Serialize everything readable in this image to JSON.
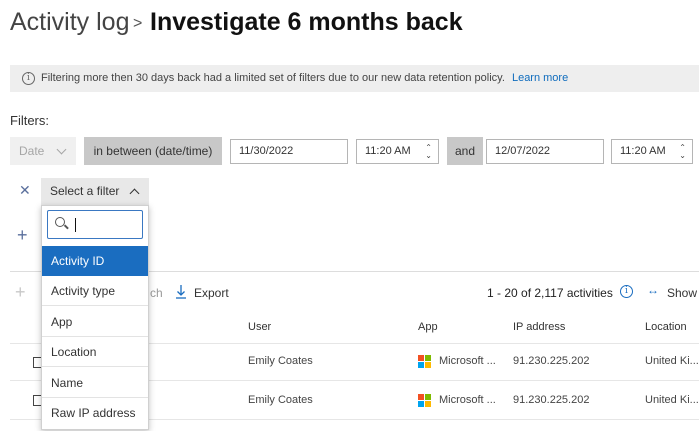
{
  "header": {
    "breadcrumb": "Activity log",
    "separator": ">",
    "title": "Investigate 6 months back"
  },
  "banner": {
    "text": "Filtering more then 30 days back had a limited set of filters due to our new data retention policy.",
    "link": "Learn more",
    "icon": "info-icon"
  },
  "filters": {
    "label": "Filters:",
    "field": "Date",
    "operator": "in between (date/time)",
    "from_date": "11/30/2022",
    "from_time": "11:20 AM",
    "and_label": "and",
    "to_date": "12/07/2022",
    "to_time": "11:20 AM",
    "select_placeholder": "Select a filter",
    "search_value": "",
    "options": [
      "Activity ID",
      "Activity type",
      "App",
      "Location",
      "Name",
      "Raw IP address"
    ],
    "selected_option": "Activity ID"
  },
  "toolbar": {
    "faded_text": "ch",
    "export_label": "Export",
    "count_text": "1 - 20 of 2,117 activities",
    "show_label": "Show"
  },
  "table": {
    "columns": [
      "User",
      "App",
      "IP address",
      "Location"
    ],
    "rows": [
      {
        "user": "Emily Coates",
        "app": "Microsoft ...",
        "ip": "91.230.225.202",
        "location": "United Ki..."
      },
      {
        "user": "Emily Coates",
        "app": "Microsoft ...",
        "ip": "91.230.225.202",
        "location": "United Ki..."
      }
    ]
  },
  "colors": {
    "accent": "#1a6dc0",
    "ms_red": "#f25022",
    "ms_green": "#7fba00",
    "ms_blue": "#00a4ef",
    "ms_yellow": "#ffb900"
  }
}
